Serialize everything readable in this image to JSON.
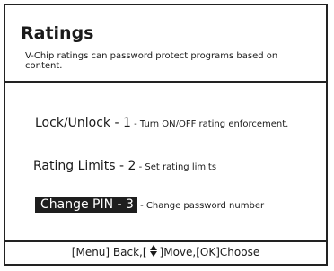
{
  "header": {
    "title": "Ratings",
    "subtitle": "V-Chip ratings can password protect programs based on content."
  },
  "menu": {
    "items": [
      {
        "label": "Lock/Unlock - 1",
        "description": " - Turn ON/OFF rating enforcement.",
        "selected": false
      },
      {
        "label": "Rating Limits - 2",
        "description": " - Set rating limits",
        "selected": false
      },
      {
        "label": "Change PIN - 3",
        "description": " - Change password number",
        "selected": true
      }
    ]
  },
  "footer": {
    "part1": "[Menu] Back,[",
    "nav_icon": "up-down-arrows-icon",
    "part2": "]Move,[OK]Choose"
  },
  "colors": {
    "border": "#222222",
    "selection_bg": "#1e1e1e",
    "selection_text": "#ffffff",
    "background": "#ffffff"
  }
}
